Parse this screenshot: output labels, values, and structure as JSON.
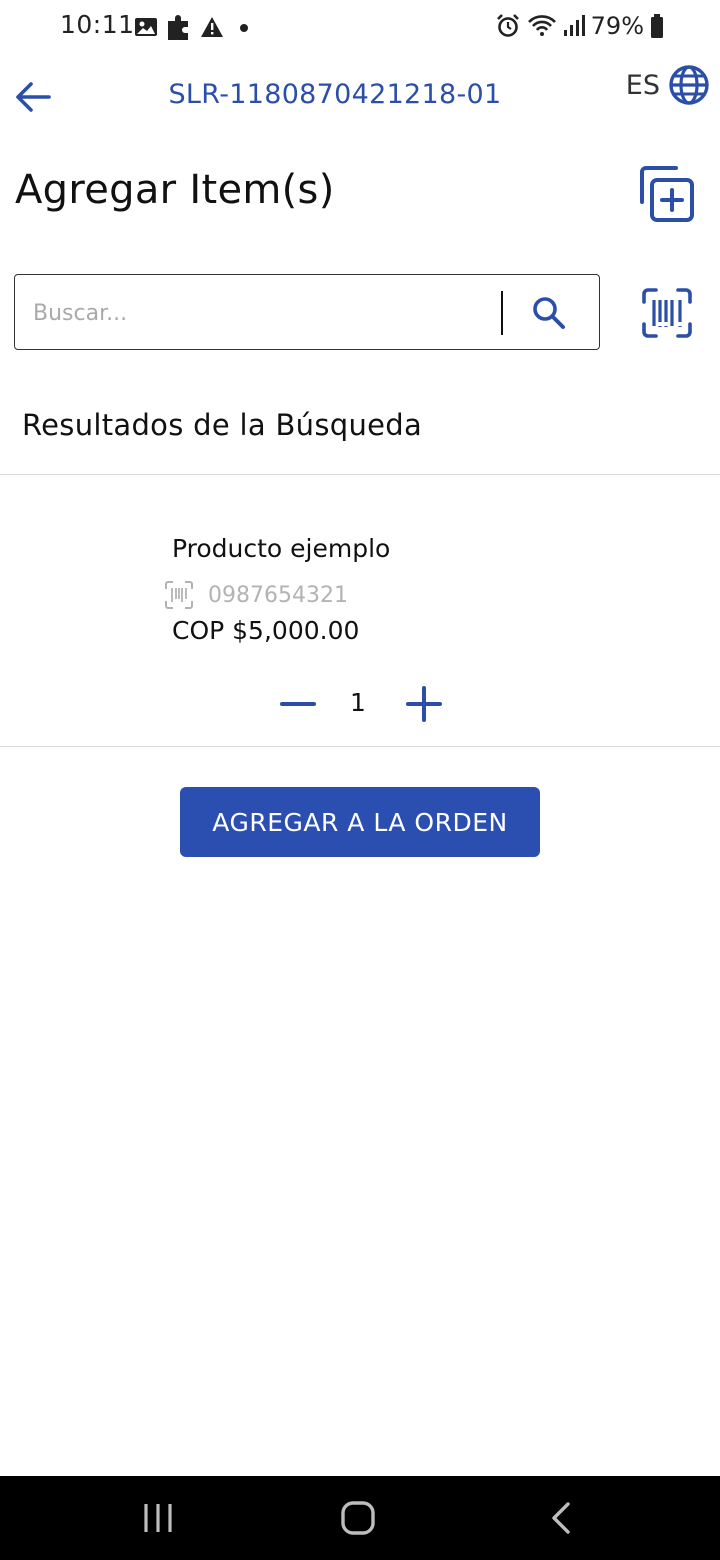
{
  "status_bar": {
    "time": "10:11",
    "battery": "79%",
    "icons_left": [
      "image-icon",
      "puzzle-icon",
      "warning-icon",
      "dot-icon"
    ],
    "icons_right": [
      "alarm-icon",
      "wifi-icon",
      "signal-icon",
      "battery-icon"
    ]
  },
  "header": {
    "order_id": "SLR-1180870421218-01",
    "language": "ES"
  },
  "page": {
    "title": "Agregar Item(s)"
  },
  "search": {
    "placeholder": "Buscar...",
    "value": ""
  },
  "results": {
    "heading": "Resultados de la Búsqueda",
    "items": [
      {
        "name": "Producto ejemplo",
        "sku": "0987654321",
        "price": "COP $5,000.00",
        "quantity": "1"
      }
    ]
  },
  "actions": {
    "add_to_order_label": "AGREGAR A LA ORDEN"
  },
  "colors": {
    "accent": "#2b4fb0",
    "text": "#111111",
    "muted": "#b3b3b3"
  }
}
